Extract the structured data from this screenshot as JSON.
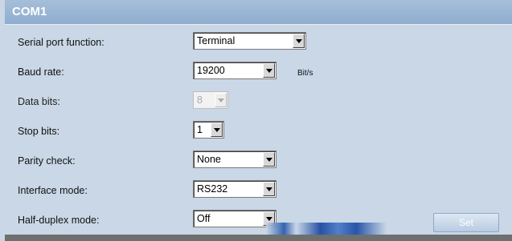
{
  "header": {
    "title": "COM1"
  },
  "fields": [
    {
      "label": "Serial port function:",
      "value": "Terminal"
    },
    {
      "label": "Baud rate:",
      "value": "19200",
      "unit": "Bit/s"
    },
    {
      "label": "Data bits:",
      "value": "8",
      "disabled": true
    },
    {
      "label": "Stop bits:",
      "value": "1"
    },
    {
      "label": "Parity check:",
      "value": "None"
    },
    {
      "label": "Interface mode:",
      "value": "RS232"
    },
    {
      "label": "Half-duplex mode:",
      "value": "Off"
    }
  ],
  "actions": {
    "set_label": "Set"
  }
}
